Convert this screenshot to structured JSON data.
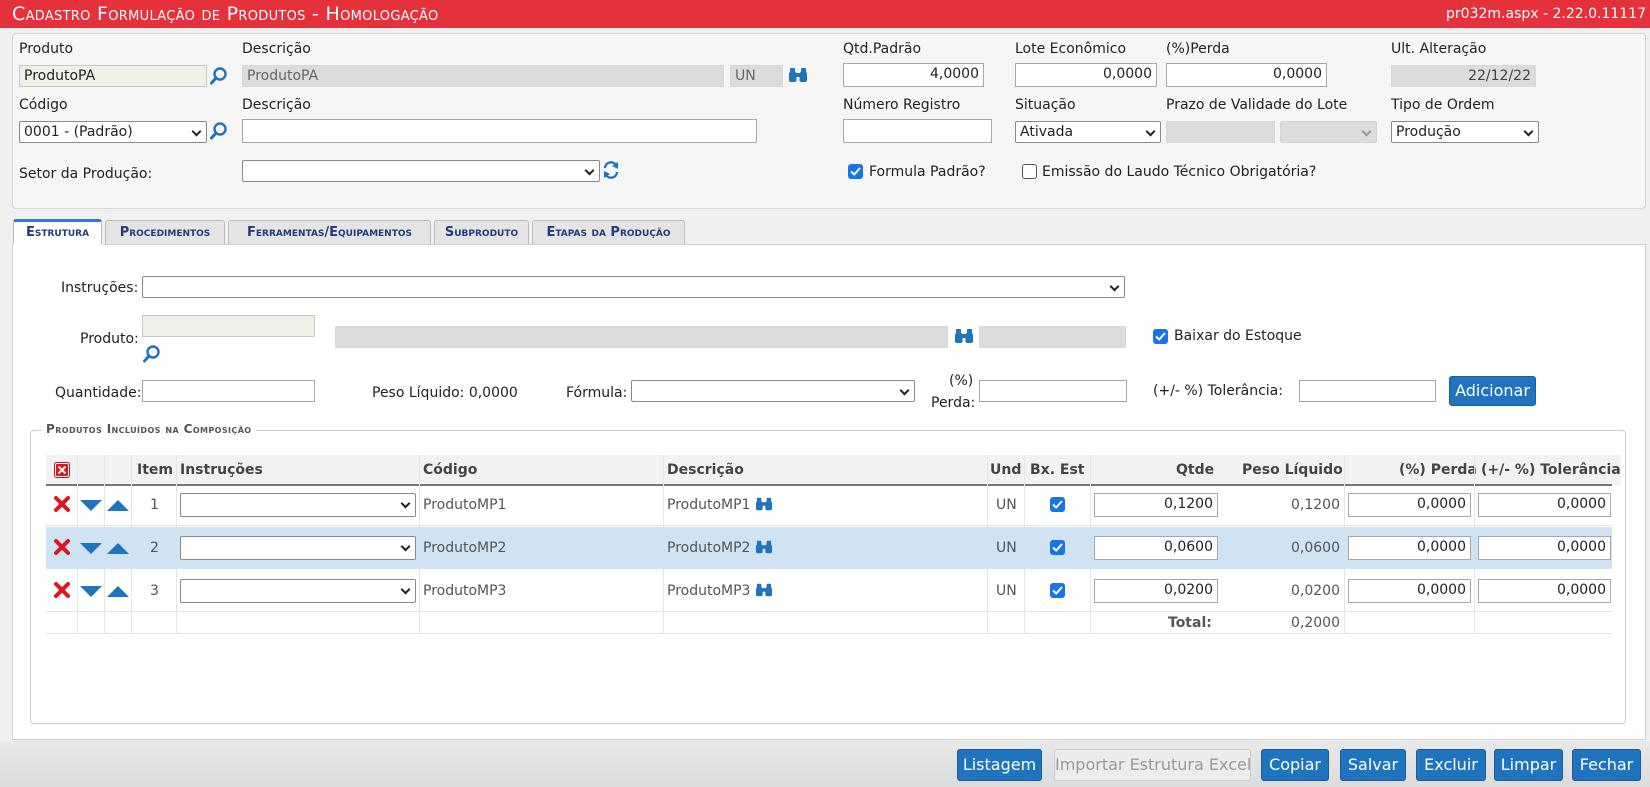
{
  "window": {
    "title": "Cadastro Formulação de Produtos  - Homologação",
    "version": "pr032m.aspx - 2.22.0.11117"
  },
  "header": {
    "produto_label": "Produto",
    "produto_value": "ProdutoPA",
    "descricao_label": "Descrição",
    "descricao_value": "ProdutoPA",
    "unidade_value": "UN",
    "qtd_padrao_label": "Qtd.Padrão",
    "qtd_padrao_value": "4,0000",
    "lote_economico_label": "Lote Econômico",
    "lote_economico_value": "0,0000",
    "perda_label": "(%)Perda",
    "perda_value": "0,0000",
    "ult_alteracao_label": "Ult. Alteração",
    "ult_alteracao_value": "22/12/22",
    "codigo_label": "Código",
    "codigo_value": "0001 - (Padrão)",
    "descricao2_label": "Descrição",
    "descricao2_value": "",
    "numero_registro_label": "Número Registro",
    "numero_registro_value": "",
    "situacao_label": "Situação",
    "situacao_value": "Ativada",
    "prazo_validade_label": "Prazo de Validade do Lote",
    "tipo_ordem_label": "Tipo de Ordem",
    "tipo_ordem_value": "Produção",
    "setor_label": "Setor da Produção:",
    "setor_value": "",
    "formula_padrao_label": "Formula Padrão?",
    "formula_padrao_checked": true,
    "laudo_label": "Emissão do Laudo Técnico Obrigatória?",
    "laudo_checked": false
  },
  "tabs": [
    {
      "label": "Estrutura",
      "active": true
    },
    {
      "label": "Procedimentos",
      "active": false
    },
    {
      "label": "Ferramentas/Equipamentos",
      "active": false
    },
    {
      "label": "Subproduto",
      "active": false
    },
    {
      "label": "Etapas da Produção",
      "active": false
    }
  ],
  "form": {
    "instrucoes_label": "Instruções:",
    "produto_label": "Produto:",
    "baixar_estoque_label": "Baixar do Estoque",
    "baixar_estoque_checked": true,
    "quantidade_label": "Quantidade:",
    "peso_liquido_label": "Peso Líquido: 0,0000",
    "formula_label": "Fórmula:",
    "perda_label_line1": "(%)",
    "perda_label_line2": "Perda:",
    "tolerancia_label": "(+/- %) Tolerância:",
    "adicionar_label": "Adicionar"
  },
  "composicao": {
    "group_title": "Produtos Incluídos na Composição",
    "columns": [
      "Item",
      "Instruções",
      "Código",
      "Descrição",
      "Und",
      "Bx. Est",
      "Qtde",
      "Peso Líquido",
      "(%) Perda",
      "(+/- %) Tolerância"
    ],
    "rows": [
      {
        "item": "1",
        "instrucoes": "",
        "codigo": "ProdutoMP1",
        "descricao": "ProdutoMP1",
        "und": "UN",
        "bx_est": true,
        "qtde": "0,1200",
        "peso_liquido": "0,1200",
        "perda": "0,0000",
        "tolerancia": "0,0000",
        "highlighted": false
      },
      {
        "item": "2",
        "instrucoes": "",
        "codigo": "ProdutoMP2",
        "descricao": "ProdutoMP2",
        "und": "UN",
        "bx_est": true,
        "qtde": "0,0600",
        "peso_liquido": "0,0600",
        "perda": "0,0000",
        "tolerancia": "0,0000",
        "highlighted": true
      },
      {
        "item": "3",
        "instrucoes": "",
        "codigo": "ProdutoMP3",
        "descricao": "ProdutoMP3",
        "und": "UN",
        "bx_est": true,
        "qtde": "0,0200",
        "peso_liquido": "0,0200",
        "perda": "0,0000",
        "tolerancia": "0,0000",
        "highlighted": false
      }
    ],
    "total_label": "Total:",
    "total_value": "0,2000"
  },
  "footer": {
    "listagem": "Listagem",
    "importar": "Importar Estrutura Excel",
    "copiar": "Copiar",
    "salvar": "Salvar",
    "excluir": "Excluir",
    "limpar": "Limpar",
    "fechar": "Fechar"
  },
  "colors": {
    "title_bar": "#e5313c",
    "accent_blue": "#1f74bd",
    "row_highlight": "#cfe3f3",
    "delete_red": "#e0141c"
  },
  "icons": [
    "magnifier-icon",
    "binoculars-icon",
    "refresh-icon",
    "delete-x-icon",
    "arrow-down-icon",
    "arrow-up-icon",
    "delete-all-icon"
  ]
}
